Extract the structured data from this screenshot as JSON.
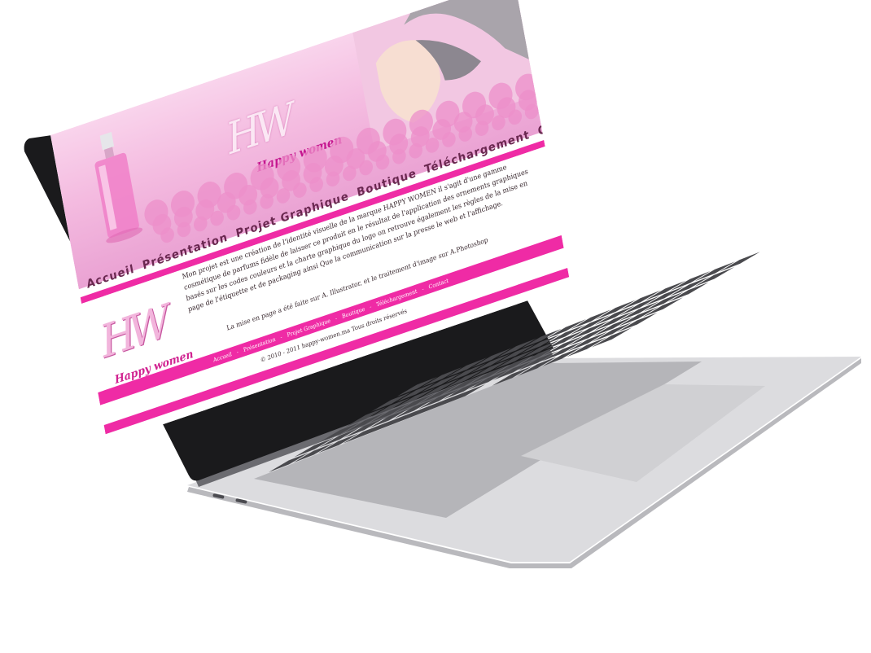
{
  "site": {
    "brand_monogram": "HW",
    "brand_tagline": "Happy women",
    "nav": [
      {
        "label": "Accueil"
      },
      {
        "label": "Présentation"
      },
      {
        "label": "Projet Graphique"
      },
      {
        "label": "Boutique"
      },
      {
        "label": "Téléchargement"
      },
      {
        "label": "Contact"
      }
    ],
    "paragraph": "Mon projet est une création de l'identité visuelle de la marque HAPPY WOMEN il s'agit d'une gamme cosmétique de parfums fidèle de laisser ce produit en le résultat de l'application des ornements graphiques basés sur les codes couleurs et la charte graphique du logo on retrouve également les règles de la mise en page de l'étiquette et de packaging ainsi Que la communication sur la presse le web et l'affichage.",
    "note": "La mise en page a été faite sur A. Illustrator, et le traitement d'image sur A.Photoshop",
    "footer_links": [
      {
        "label": "Accueil"
      },
      {
        "label": "Présentation"
      },
      {
        "label": "Projet Graphique"
      },
      {
        "label": "Boutique"
      },
      {
        "label": "Téléchargement"
      },
      {
        "label": "Contact"
      }
    ],
    "footer_separator": "-",
    "copyright": "© 2010 - 2011 happy-women.ma Tous droits réservés"
  },
  "colors": {
    "accent_pink": "#ef2ba5",
    "light_pink": "#f4bbe0",
    "laptop_silver": "#d9d9dc",
    "bezel": "#1a1a1c",
    "keys": "#4a4a4e"
  }
}
